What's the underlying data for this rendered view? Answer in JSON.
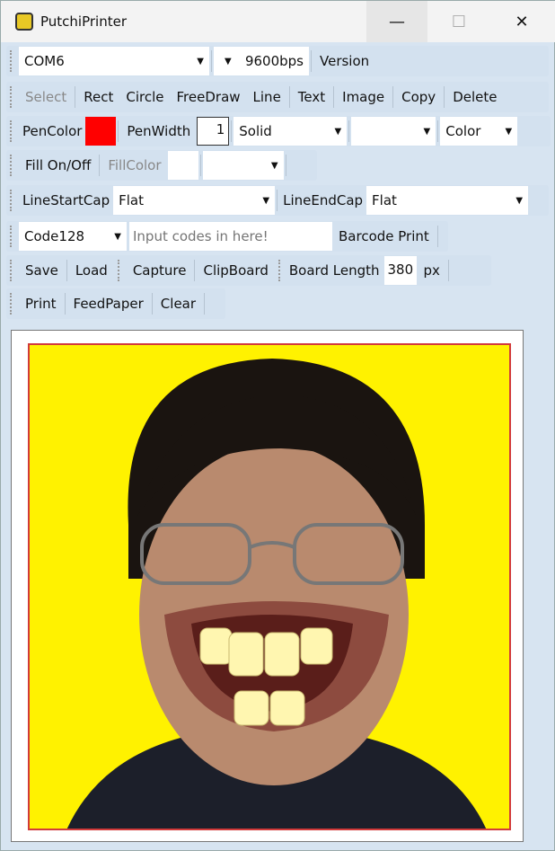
{
  "window": {
    "title": "PutchiPrinter",
    "minimize": "—",
    "maximize": "☐",
    "close": "✕"
  },
  "row1": {
    "port": "COM6",
    "baud": "9600bps",
    "version": "Version"
  },
  "row2": {
    "tools": [
      "Select",
      "Rect",
      "Circle",
      "FreeDraw",
      "Line",
      "Text",
      "Image",
      "Copy",
      "Delete"
    ]
  },
  "row3": {
    "pen_color_label": "PenColor",
    "pen_color": "#ff0000",
    "pen_width_label": "PenWidth",
    "pen_width": "1",
    "dash": "Solid",
    "extra": "",
    "color_mode": "Color"
  },
  "row4": {
    "fill": "Fill On/Off",
    "fill_color": "FillColor"
  },
  "row5": {
    "start_label": "LineStartCap",
    "start": "Flat",
    "end_label": "LineEndCap",
    "end": "Flat"
  },
  "row6": {
    "barcode_type": "Code128",
    "placeholder": "Input codes in here!",
    "barcode_print": "Barcode Print"
  },
  "row7": {
    "save": "Save",
    "load": "Load",
    "capture": "Capture",
    "clipboard": "ClipBoard",
    "board_length_label": "Board Length",
    "board_length": "380",
    "unit": "px"
  },
  "row8": {
    "print": "Print",
    "feed": "FeedPaper",
    "clear": "Clear"
  }
}
